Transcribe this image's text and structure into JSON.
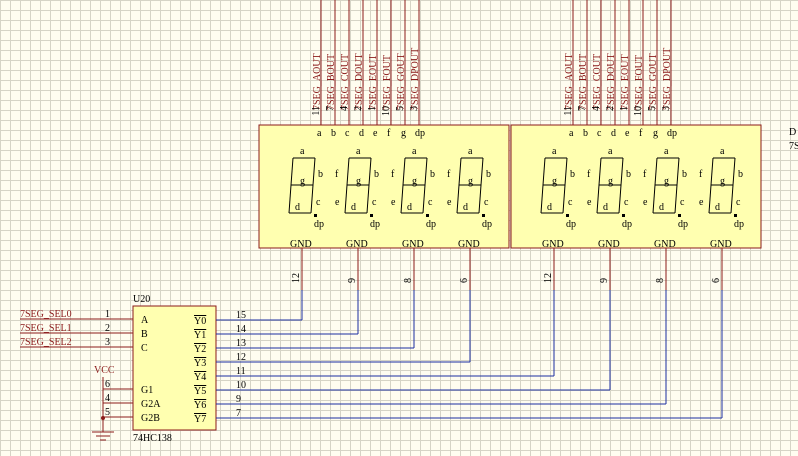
{
  "display": {
    "net_labels": [
      "7SEG_AOUT",
      "7SEG_BOUT",
      "7SEG_COUT",
      "7SEG_DOUT",
      "7SEG_EOUT",
      "7SEG_FOUT",
      "7SEG_GOUT",
      "7SEG_DPOUT"
    ],
    "pin_numbers": [
      "11",
      "7",
      "4",
      "2",
      "1",
      "10",
      "5",
      "3"
    ],
    "top_pins": [
      "a",
      "b",
      "c",
      "d",
      "e",
      "f",
      "g",
      "dp"
    ],
    "seg_labels": {
      "a": "a",
      "b": "b",
      "c": "c",
      "d": "d",
      "e": "e",
      "f": "f",
      "g": "g",
      "dp": "dp"
    },
    "gnd_label": "GND",
    "gnd_pins_left": [
      "12",
      "9",
      "8",
      "6"
    ],
    "gnd_pins_right": [
      "12",
      "9",
      "8",
      "6"
    ],
    "edge_label_top": "D",
    "edge_label_bottom": "7S"
  },
  "decoder": {
    "ref": "U20",
    "part": "74HC138",
    "vcc": "VCC",
    "input_nets": [
      "7SEG_SEL0",
      "7SEG_SEL1",
      "7SEG_SEL2"
    ],
    "input_pin_numbers": [
      "1",
      "2",
      "3"
    ],
    "input_pins": [
      "A",
      "B",
      "C"
    ],
    "enable_pin_numbers": [
      "6",
      "4",
      "5"
    ],
    "enable_pins": [
      "G1",
      "G2A",
      "G2B"
    ],
    "outputs": [
      "Y0",
      "Y1",
      "Y2",
      "Y3",
      "Y4",
      "Y5",
      "Y6",
      "Y7"
    ],
    "output_pin_numbers": [
      "15",
      "14",
      "13",
      "12",
      "11",
      "10",
      "9",
      "7"
    ]
  },
  "colors": {
    "component_fill": "#ffffb0",
    "component_stroke": "#8b1a1a",
    "wire": "#1c2fa0",
    "net_label": "#8b1a1a"
  }
}
